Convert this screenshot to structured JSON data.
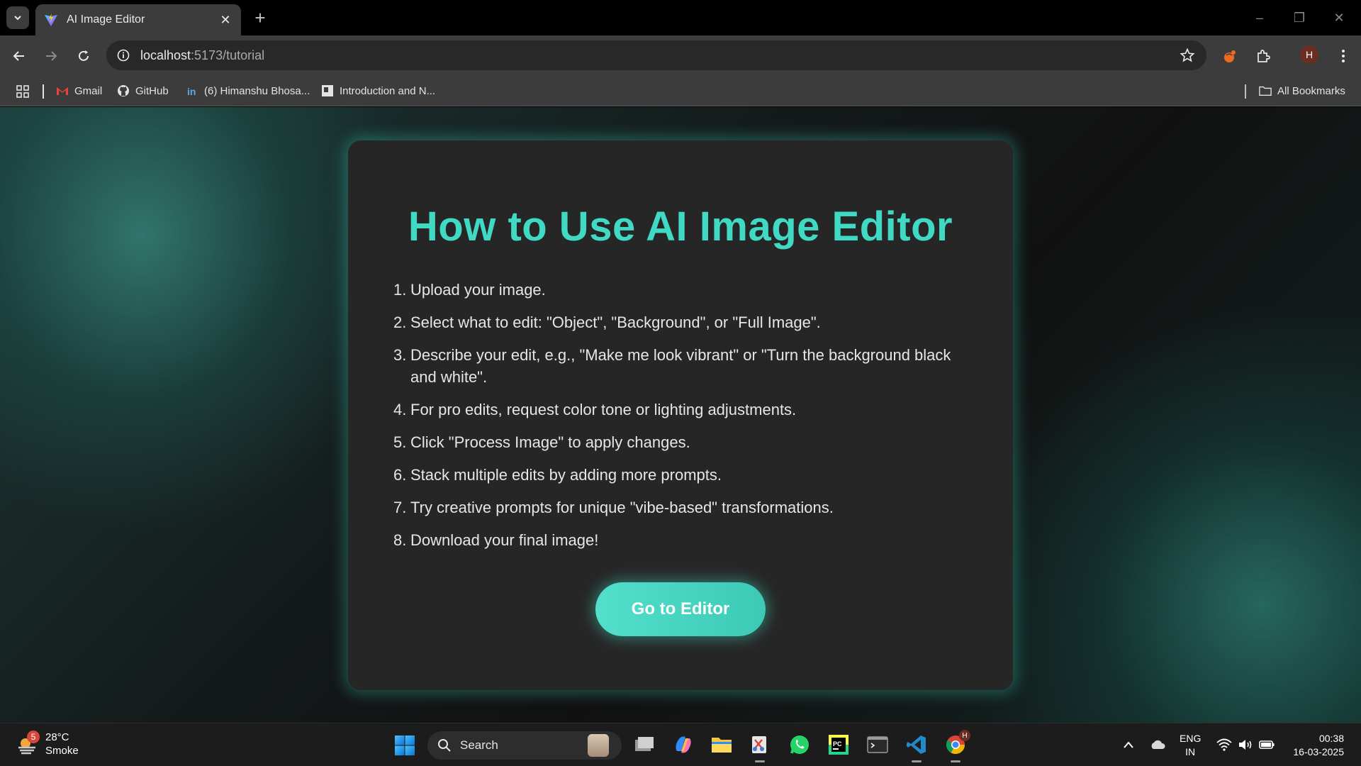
{
  "browser": {
    "tab_title": "AI Image Editor",
    "url_host": "localhost",
    "url_path": ":5173/tutorial",
    "profile_initial": "H",
    "bookmarks": [
      {
        "label": "Gmail",
        "icon": "gmail-icon"
      },
      {
        "label": "GitHub",
        "icon": "github-icon"
      },
      {
        "label": "(6) Himanshu Bhosa...",
        "icon": "linkedin-icon"
      },
      {
        "label": "Introduction and N...",
        "icon": "doc-icon"
      }
    ],
    "all_bookmarks_label": "All Bookmarks"
  },
  "page": {
    "title": "How to Use AI Image Editor",
    "steps": [
      {
        "num": "1.",
        "text": "Upload your image."
      },
      {
        "num": "2.",
        "text": "Select what to edit: \"Object\", \"Background\", or \"Full Image\"."
      },
      {
        "num": "3.",
        "text": "Describe your edit, e.g., \"Make me look vibrant\" or \"Turn the background black and white\"."
      },
      {
        "num": "4.",
        "text": "For pro edits, request color tone or lighting adjustments."
      },
      {
        "num": "5.",
        "text": "Click \"Process Image\" to apply changes."
      },
      {
        "num": "6.",
        "text": "Stack multiple edits by adding more prompts."
      },
      {
        "num": "7.",
        "text": "Try creative prompts for unique \"vibe-based\" transformations."
      },
      {
        "num": "8.",
        "text": "Download your final image!"
      }
    ],
    "cta_label": "Go to Editor",
    "accent_color": "#3fd9c4"
  },
  "taskbar": {
    "weather_badge": "5",
    "temperature": "28°C",
    "condition": "Smoke",
    "search_label": "Search",
    "lang_line1": "ENG",
    "lang_line2": "IN",
    "time": "00:38",
    "date": "16-03-2025",
    "chrome_badge": "H"
  }
}
